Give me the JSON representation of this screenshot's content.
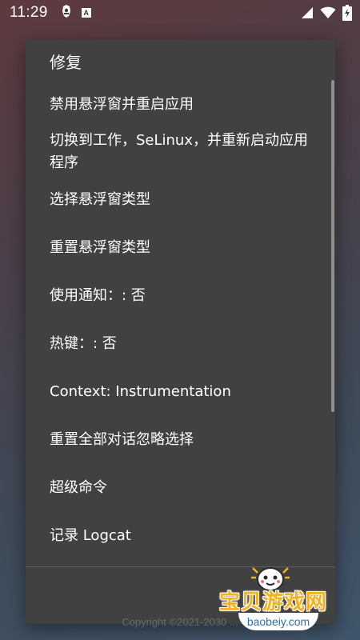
{
  "status_bar": {
    "time": "11:29",
    "left_icons": [
      "game-controller-icon",
      "a-badge-icon"
    ],
    "right_icons": [
      "signal-icon",
      "wifi-icon",
      "battery-charging-icon"
    ],
    "a_badge_text": "A"
  },
  "dialog": {
    "title": "修复",
    "items": [
      {
        "label": "禁用悬浮窗并重启应用"
      },
      {
        "label": "切换到工作，SeLinux，并重新启动应用程序"
      },
      {
        "label": "选择悬浮窗类型"
      },
      {
        "label": "重置悬浮窗类型"
      },
      {
        "label": "使用通知：: 否"
      },
      {
        "label": "热键：: 否"
      },
      {
        "label": "Context: Instrumentation"
      },
      {
        "label": "重置全部对话忽略选择"
      },
      {
        "label": "超级命令"
      },
      {
        "label": "记录 Logcat"
      }
    ]
  },
  "footer": {
    "copyright": "Copyright ©2021-2030 ..."
  },
  "watermark": {
    "title": "宝贝游戏网",
    "url": "baobeiy.com"
  },
  "colors": {
    "dialog_bg": "#414141",
    "watermark_gold": "#f5b21b",
    "watermark_blue": "#2d6fb8"
  }
}
